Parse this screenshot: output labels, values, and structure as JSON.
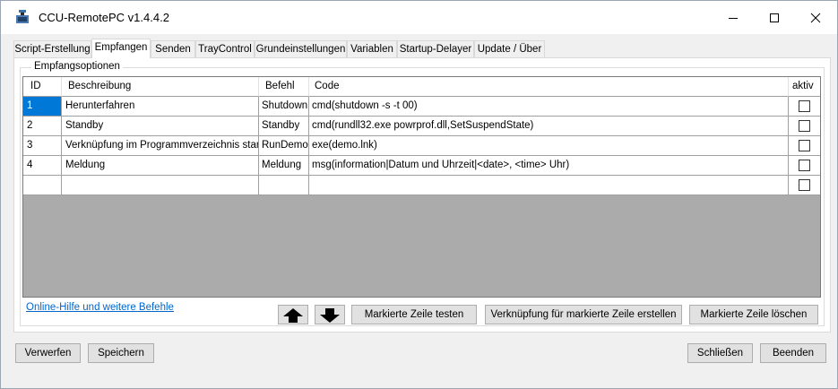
{
  "window": {
    "title": "CCU-RemotePC v1.4.4.2",
    "controls": [
      "minimize-icon",
      "maximize-icon",
      "close-icon"
    ]
  },
  "tabs": [
    {
      "label": "Script-Erstellung",
      "active": false
    },
    {
      "label": "Empfangen",
      "active": true
    },
    {
      "label": "Senden",
      "active": false
    },
    {
      "label": "TrayControl",
      "active": false
    },
    {
      "label": "Grundeinstellungen",
      "active": false
    },
    {
      "label": "Variablen",
      "active": false
    },
    {
      "label": "Startup-Delayer",
      "active": false
    },
    {
      "label": "Update / Über",
      "active": false
    }
  ],
  "group": {
    "label": "Empfangsoptionen"
  },
  "table": {
    "columns": [
      "ID",
      "Beschreibung",
      "Befehl",
      "Code",
      "aktiv"
    ],
    "rows": [
      {
        "id": "1",
        "beschreibung": "Herunterfahren",
        "befehl": "Shutdown",
        "code": "cmd(shutdown -s -t 00)",
        "aktiv": false
      },
      {
        "id": "2",
        "beschreibung": "Standby",
        "befehl": "Standby",
        "code": "cmd(rundll32.exe powrprof.dll,SetSuspendState)",
        "aktiv": false
      },
      {
        "id": "3",
        "beschreibung": "Verknüpfung im Programmverzeichnis starten",
        "befehl": "RunDemo",
        "code": "exe(demo.lnk)",
        "aktiv": false
      },
      {
        "id": "4",
        "beschreibung": "Meldung",
        "befehl": "Meldung",
        "code": "msg(information|Datum und Uhrzeit|<date>, <time> Uhr)",
        "aktiv": false
      },
      {
        "id": "",
        "beschreibung": "",
        "befehl": "",
        "code": "",
        "aktiv": false
      }
    ],
    "selected_cell": "row-1-id"
  },
  "actions": {
    "help_link": "Online-Hilfe und weitere Befehle",
    "move_up_icon": "arrow-up-icon",
    "move_down_icon": "arrow-down-icon",
    "test_row": "Markierte Zeile testen",
    "create_shortcut": "Verknüpfung für markierte Zeile erstellen",
    "delete_row": "Markierte Zeile löschen"
  },
  "footer": {
    "discard": "Verwerfen",
    "save": "Speichern",
    "close": "Schließen",
    "exit": "Beenden"
  },
  "colors": {
    "selection": "#0078d7",
    "grid_background": "#ababab",
    "link": "#0066cc",
    "window_background": "#f0f0f0"
  }
}
